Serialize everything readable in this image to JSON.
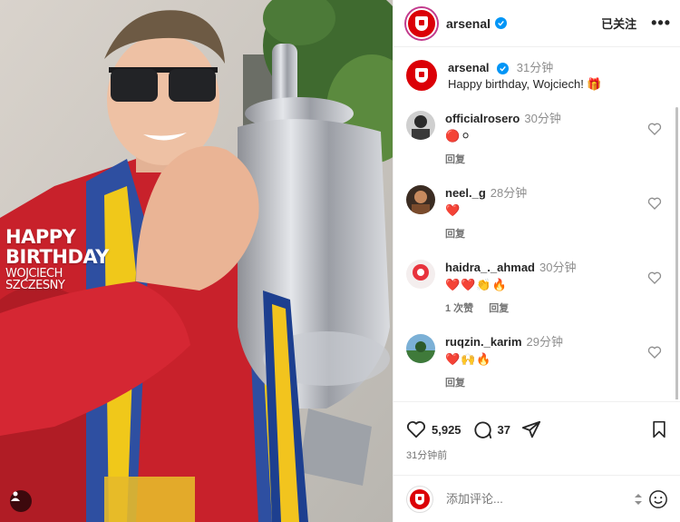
{
  "post_image": {
    "overlay_line1": "HAPPY",
    "overlay_line2": "BIRTHDAY",
    "overlay_line3": "WOJCIECH",
    "overlay_line4": "SZCZESNY",
    "tag_icon": "user-tag-icon"
  },
  "header": {
    "username": "arsenal",
    "verified": true,
    "follow_label": "已关注",
    "more_label": "•••"
  },
  "caption": {
    "username": "arsenal",
    "time": "31分钟",
    "text": "Happy birthday, Wojciech! 🎁"
  },
  "comments": [
    {
      "username": "officialrosero",
      "time": "30分钟",
      "text": "🔴⚪",
      "actions": [
        "回复"
      ]
    },
    {
      "username": "neel._g",
      "time": "28分钟",
      "text": "❤️",
      "actions": [
        "回复"
      ]
    },
    {
      "username": "haidra_._ahmad",
      "time": "30分钟",
      "text": "❤️❤️👏🔥",
      "actions": [
        "1 次赞",
        "回复"
      ]
    },
    {
      "username": "ruqzin._karim",
      "time": "29分钟",
      "text": "❤️🙌🔥",
      "actions": [
        "回复"
      ]
    }
  ],
  "stats": {
    "likes": "5,925",
    "comments": "37",
    "posted_ago": "31分钟前"
  },
  "add_comment": {
    "placeholder": "添加评论..."
  },
  "colors": {
    "arsenal_red": "#db0007",
    "verified_blue": "#0095f6",
    "muted_text": "#737373"
  }
}
